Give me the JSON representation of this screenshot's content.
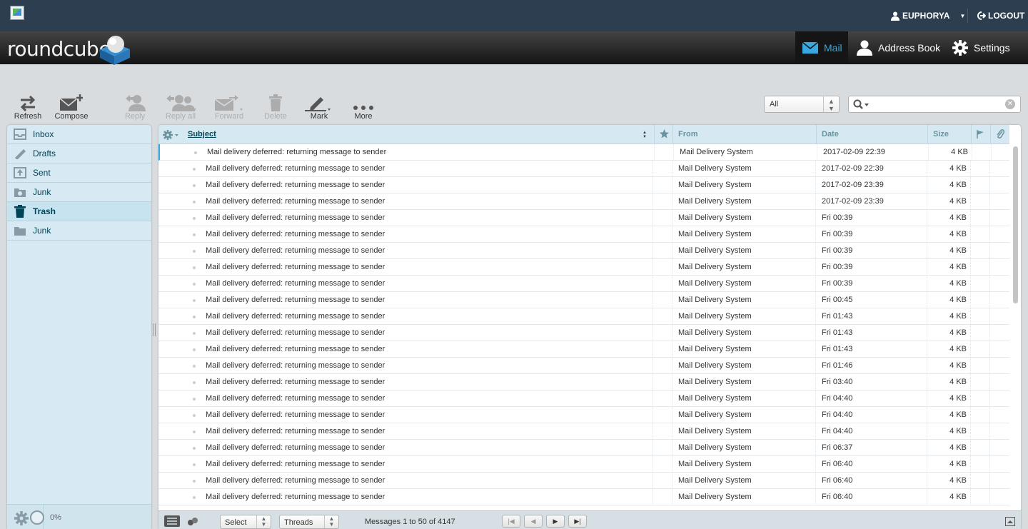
{
  "topbar": {
    "username": "EUPHORYA",
    "logout_label": "LOGOUT"
  },
  "header": {
    "logo_text": "roundcube",
    "tasks": {
      "mail": "Mail",
      "addressbook": "Address Book",
      "settings": "Settings"
    }
  },
  "toolbar": {
    "refresh": "Refresh",
    "compose": "Compose",
    "reply": "Reply",
    "reply_all": "Reply all",
    "forward": "Forward",
    "delete": "Delete",
    "mark": "Mark",
    "more": "More",
    "filter_value": "All",
    "search_placeholder": ""
  },
  "folders": [
    {
      "label": "Inbox",
      "icon": "inbox-icon"
    },
    {
      "label": "Drafts",
      "icon": "pencil-icon"
    },
    {
      "label": "Sent",
      "icon": "sent-icon"
    },
    {
      "label": "Junk",
      "icon": "junk-icon"
    },
    {
      "label": "Trash",
      "icon": "trash-icon",
      "selected": true
    },
    {
      "label": "Junk",
      "icon": "folder-icon"
    }
  ],
  "quota": "0%",
  "list": {
    "columns": {
      "subject": "Subject",
      "from": "From",
      "date": "Date",
      "size": "Size"
    },
    "messages": [
      {
        "subject": "Mail delivery deferred: returning message to sender",
        "from": "Mail Delivery System",
        "date": "2017-02-09 22:39",
        "size": "4 KB"
      },
      {
        "subject": "Mail delivery deferred: returning message to sender",
        "from": "Mail Delivery System",
        "date": "2017-02-09 22:39",
        "size": "4 KB"
      },
      {
        "subject": "Mail delivery deferred: returning message to sender",
        "from": "Mail Delivery System",
        "date": "2017-02-09 23:39",
        "size": "4 KB"
      },
      {
        "subject": "Mail delivery deferred: returning message to sender",
        "from": "Mail Delivery System",
        "date": "2017-02-09 23:39",
        "size": "4 KB"
      },
      {
        "subject": "Mail delivery deferred: returning message to sender",
        "from": "Mail Delivery System",
        "date": "Fri 00:39",
        "size": "4 KB"
      },
      {
        "subject": "Mail delivery deferred: returning message to sender",
        "from": "Mail Delivery System",
        "date": "Fri 00:39",
        "size": "4 KB"
      },
      {
        "subject": "Mail delivery deferred: returning message to sender",
        "from": "Mail Delivery System",
        "date": "Fri 00:39",
        "size": "4 KB"
      },
      {
        "subject": "Mail delivery deferred: returning message to sender",
        "from": "Mail Delivery System",
        "date": "Fri 00:39",
        "size": "4 KB"
      },
      {
        "subject": "Mail delivery deferred: returning message to sender",
        "from": "Mail Delivery System",
        "date": "Fri 00:39",
        "size": "4 KB"
      },
      {
        "subject": "Mail delivery deferred: returning message to sender",
        "from": "Mail Delivery System",
        "date": "Fri 00:45",
        "size": "4 KB"
      },
      {
        "subject": "Mail delivery deferred: returning message to sender",
        "from": "Mail Delivery System",
        "date": "Fri 01:43",
        "size": "4 KB"
      },
      {
        "subject": "Mail delivery deferred: returning message to sender",
        "from": "Mail Delivery System",
        "date": "Fri 01:43",
        "size": "4 KB"
      },
      {
        "subject": "Mail delivery deferred: returning message to sender",
        "from": "Mail Delivery System",
        "date": "Fri 01:43",
        "size": "4 KB"
      },
      {
        "subject": "Mail delivery deferred: returning message to sender",
        "from": "Mail Delivery System",
        "date": "Fri 01:46",
        "size": "4 KB"
      },
      {
        "subject": "Mail delivery deferred: returning message to sender",
        "from": "Mail Delivery System",
        "date": "Fri 03:40",
        "size": "4 KB"
      },
      {
        "subject": "Mail delivery deferred: returning message to sender",
        "from": "Mail Delivery System",
        "date": "Fri 04:40",
        "size": "4 KB"
      },
      {
        "subject": "Mail delivery deferred: returning message to sender",
        "from": "Mail Delivery System",
        "date": "Fri 04:40",
        "size": "4 KB"
      },
      {
        "subject": "Mail delivery deferred: returning message to sender",
        "from": "Mail Delivery System",
        "date": "Fri 04:40",
        "size": "4 KB"
      },
      {
        "subject": "Mail delivery deferred: returning message to sender",
        "from": "Mail Delivery System",
        "date": "Fri 06:37",
        "size": "4 KB"
      },
      {
        "subject": "Mail delivery deferred: returning message to sender",
        "from": "Mail Delivery System",
        "date": "Fri 06:40",
        "size": "4 KB"
      },
      {
        "subject": "Mail delivery deferred: returning message to sender",
        "from": "Mail Delivery System",
        "date": "Fri 06:40",
        "size": "4 KB"
      },
      {
        "subject": "Mail delivery deferred: returning message to sender",
        "from": "Mail Delivery System",
        "date": "Fri 06:40",
        "size": "4 KB"
      }
    ]
  },
  "footer": {
    "select_label": "Select",
    "threads_label": "Threads",
    "count_text": "Messages 1 to 50 of 4147"
  }
}
